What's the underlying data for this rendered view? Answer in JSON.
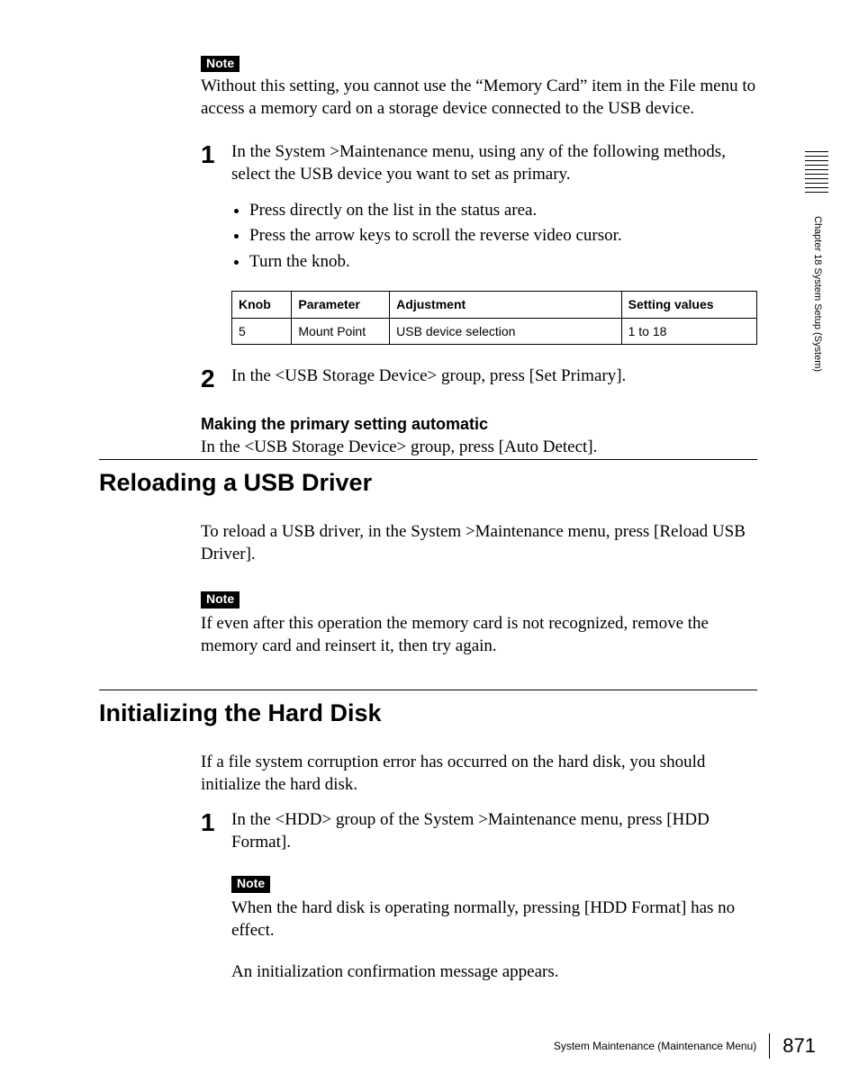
{
  "sideLabel": "Chapter 18  System Setup (System)",
  "topNoteBadge": "Note",
  "topNoteText": "Without this setting, you cannot use the “Memory Card” item in the File menu to access a memory card on a storage device connected to the USB device.",
  "step1": {
    "num": "1",
    "text": "In the System >Maintenance menu, using any of the following methods, select the USB device you want to set as primary.",
    "bullets": [
      "Press directly on the list in the status area.",
      "Press the arrow keys to scroll the reverse video cursor.",
      "Turn the knob."
    ]
  },
  "paramTable": {
    "headers": {
      "knob": "Knob",
      "parameter": "Parameter",
      "adjustment": "Adjustment",
      "setting": "Setting values"
    },
    "row": {
      "knob": "5",
      "parameter": "Mount Point",
      "adjustment": "USB device selection",
      "setting": "1 to 18"
    }
  },
  "step2": {
    "num": "2",
    "text": "In the <USB Storage Device> group, press [Set Primary]."
  },
  "autoHeading": "Making the primary setting automatic",
  "autoText": "In the <USB Storage Device> group, press [Auto Detect].",
  "sectionReload": {
    "title": "Reloading a USB Driver",
    "body": "To reload a USB driver, in the System >Maintenance menu, press [Reload USB Driver].",
    "noteBadge": "Note",
    "noteText": "If even after this operation the memory card is not recognized, remove the memory card and reinsert it, then try again."
  },
  "sectionInit": {
    "title": "Initializing the Hard Disk",
    "body": "If a file system corruption error has occurred on the hard disk, you should initialize the hard disk.",
    "step1": {
      "num": "1",
      "text": "In the <HDD> group of the System >Maintenance menu, press [HDD Format].",
      "noteBadge": "Note",
      "noteText": "When the hard disk is operating normally, pressing [HDD Format] has no effect.",
      "after": "An initialization confirmation message appears."
    }
  },
  "footer": {
    "title": "System Maintenance (Maintenance Menu)",
    "page": "871"
  }
}
